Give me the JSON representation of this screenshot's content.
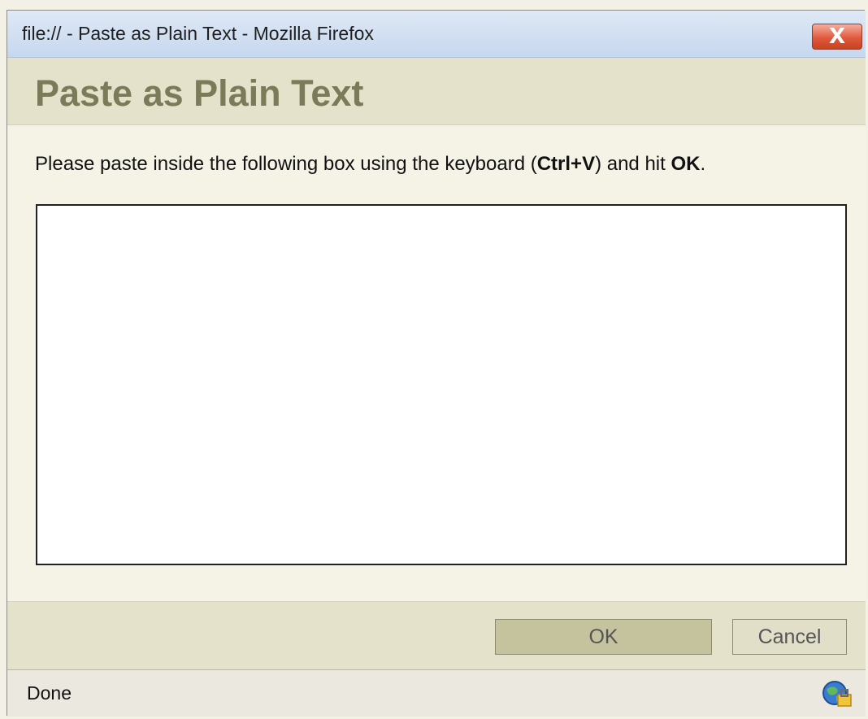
{
  "window": {
    "title": "file:// - Paste as Plain Text - Mozilla Firefox",
    "close_glyph": "X"
  },
  "dialog": {
    "title": "Paste as Plain Text",
    "instruction": {
      "before": "Please paste inside the following box using the keyboard (",
      "shortcut": "Ctrl+V",
      "middle": ") and hit ",
      "ok_word": "OK",
      "after": "."
    },
    "paste_value": ""
  },
  "buttons": {
    "ok_label": "OK",
    "cancel_label": "Cancel"
  },
  "statusbar": {
    "text": "Done",
    "icon": "security-globe-icon"
  },
  "colors": {
    "titlebar": "#c6d7ee",
    "dialog_header": "#e4e2ca",
    "dialog_title": "#7b7a59",
    "ok_button": "#c5c39d",
    "close_button": "#e05a3e"
  }
}
